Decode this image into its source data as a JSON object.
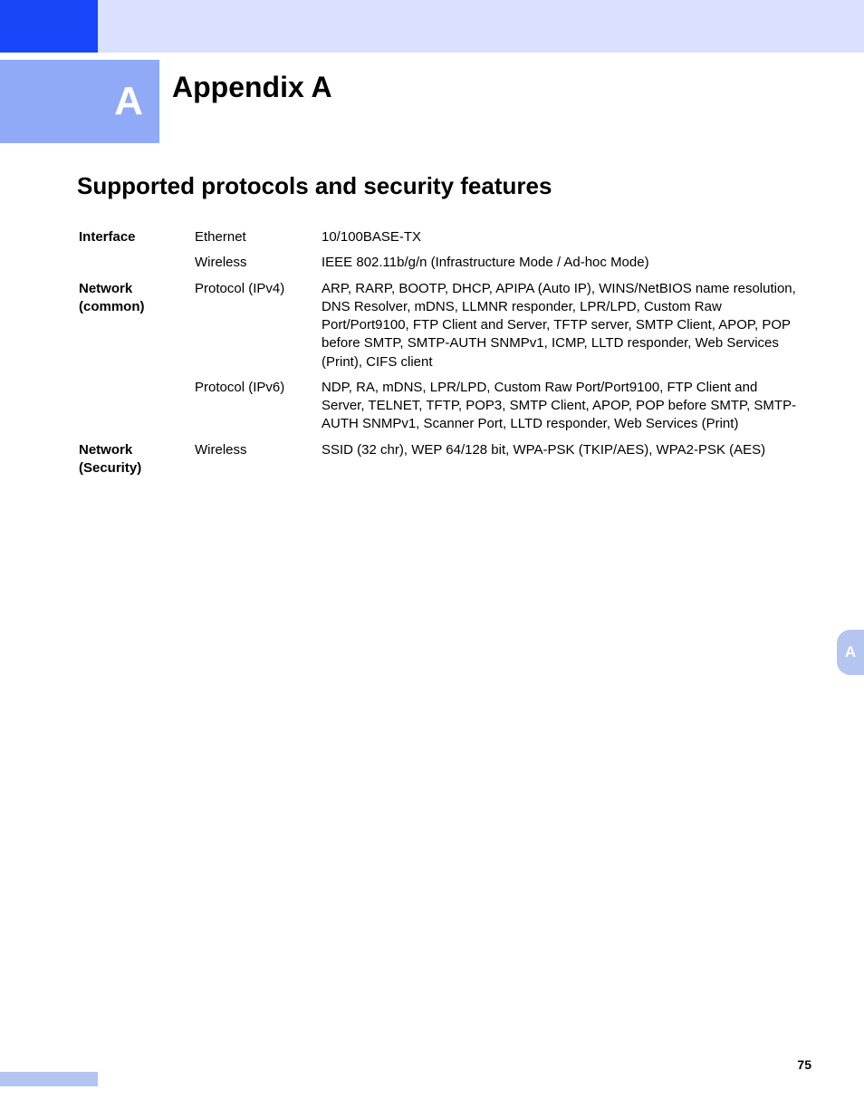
{
  "header": {
    "chapter_letter": "A",
    "chapter_title": "Appendix A"
  },
  "section": {
    "title": "Supported protocols and security features"
  },
  "table": {
    "rows": [
      {
        "cat": "Interface",
        "item": "Ethernet",
        "desc": "10/100BASE-TX"
      },
      {
        "cat": "",
        "item": "Wireless",
        "desc": "IEEE 802.11b/g/n (Infrastructure Mode / Ad-hoc Mode)"
      },
      {
        "cat": "Network (common)",
        "item": "Protocol (IPv4)",
        "desc": "ARP, RARP, BOOTP, DHCP, APIPA (Auto IP), WINS/NetBIOS name resolution, DNS Resolver, mDNS, LLMNR responder, LPR/LPD, Custom Raw Port/Port9100, FTP Client and Server, TFTP server, SMTP Client, APOP, POP before SMTP, SMTP-AUTH SNMPv1, ICMP, LLTD responder, Web Services (Print), CIFS client"
      },
      {
        "cat": "",
        "item": "Protocol (IPv6)",
        "desc": "NDP, RA, mDNS, LPR/LPD, Custom Raw Port/Port9100, FTP Client and Server, TELNET, TFTP, POP3, SMTP Client, APOP, POP before SMTP, SMTP-AUTH SNMPv1, Scanner Port, LLTD responder, Web Services (Print)"
      },
      {
        "cat": "Network (Security)",
        "item": "Wireless",
        "desc": "SSID (32 chr), WEP 64/128 bit, WPA-PSK (TKIP/AES), WPA2-PSK (AES)"
      }
    ]
  },
  "side_tab": "A",
  "page_number": "75"
}
